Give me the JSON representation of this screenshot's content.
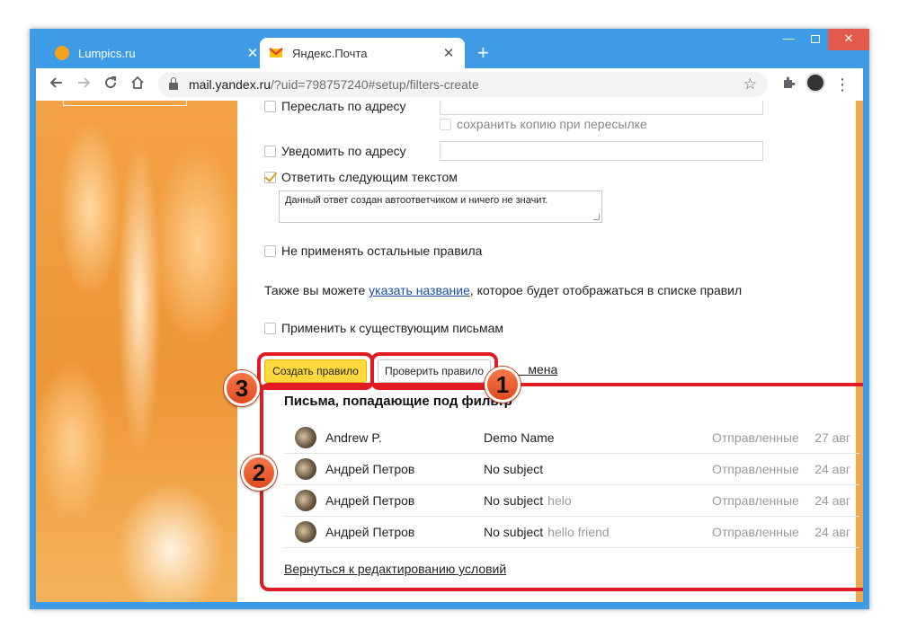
{
  "browser": {
    "tabs": [
      {
        "title": "Lumpics.ru",
        "active": false
      },
      {
        "title": "Яндекс.Почта",
        "active": true
      }
    ],
    "new_tab": "+",
    "close_glyph": "✕",
    "url_host": "mail.yandex.ru",
    "url_path": "/?uid=798757240#setup/filters-create",
    "icons": [
      "back-arrow-icon",
      "forward-arrow-icon",
      "reload-icon",
      "home-icon",
      "lock-icon",
      "star-icon",
      "extensions-icon",
      "profile-avatar-icon",
      "menu-dots-icon"
    ]
  },
  "form": {
    "forward_label": "Переслать по адресу",
    "keep_copy_label": "сохранить копию при пересылке",
    "notify_label": "Уведомить по адресу",
    "reply_label": "Ответить следующим текстом",
    "reply_text": "Данный ответ создан автоответчиком и ничего не значит.",
    "reply_checked": true,
    "stop_rules_label": "Не применять остальные правила",
    "name_hint_before": "Также вы можете ",
    "name_hint_link": "указать название",
    "name_hint_after": ", которое будет отображаться в списке правил",
    "apply_existing_label": "Применить к существующим письмам"
  },
  "actions": {
    "create_label": "Создать правило",
    "check_label": "Проверить правило",
    "cancel_label": "Отмена"
  },
  "annotations": {
    "badge_1": "1",
    "badge_2": "2",
    "badge_3": "3",
    "highlight_color": "#e21b23"
  },
  "results": {
    "title": "Письма, попадающие под фильтр",
    "messages": [
      {
        "from": "Andrew P.",
        "subject": "Demo Name",
        "snippet": "",
        "folder": "Отправленные",
        "date": "27 авг"
      },
      {
        "from": "Андрей Петров",
        "subject": "No subject",
        "snippet": "",
        "folder": "Отправленные",
        "date": "24 авг"
      },
      {
        "from": "Андрей Петров",
        "subject": "No subject",
        "snippet": "helo",
        "folder": "Отправленные",
        "date": "24 авг"
      },
      {
        "from": "Андрей Петров",
        "subject": "No subject",
        "snippet": "hello friend",
        "folder": "Отправленные",
        "date": "24 авг"
      }
    ],
    "back_link": "Вернуться к редактированию условий"
  },
  "colors": {
    "browser_frame": "#3e9be5",
    "create_button": "#ffd83b",
    "link": "#1a4fa0"
  }
}
